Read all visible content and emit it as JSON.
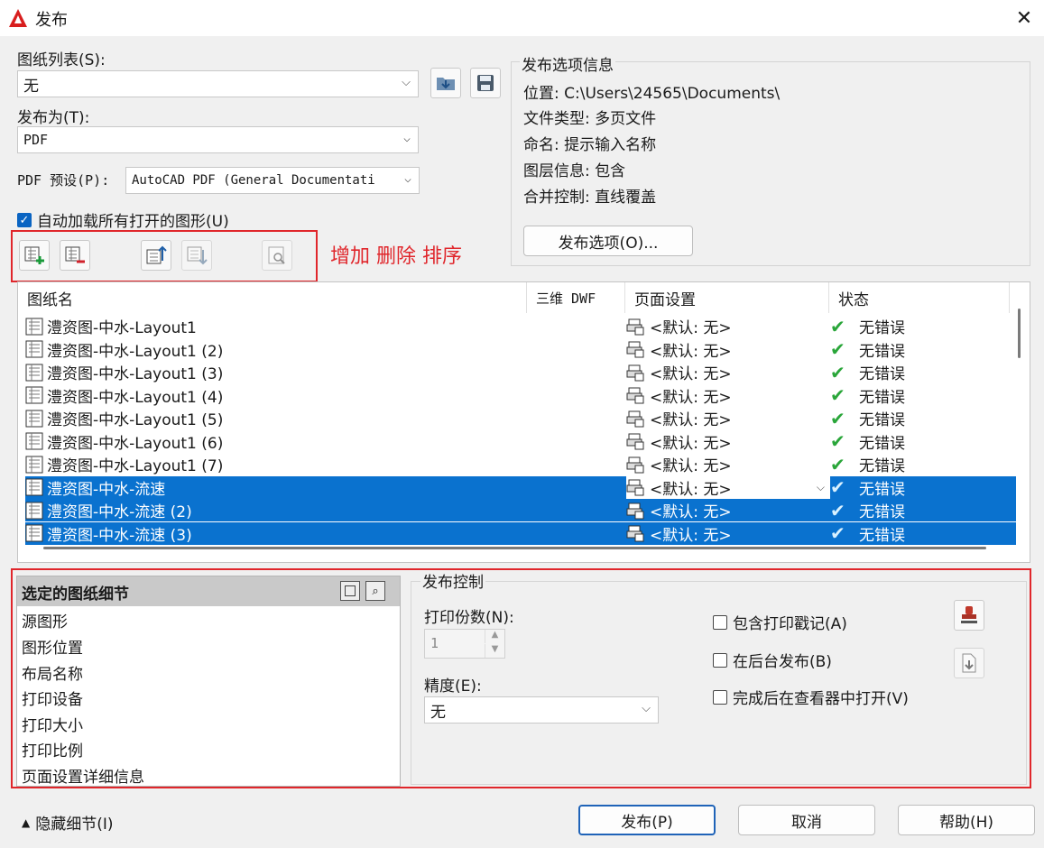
{
  "window": {
    "title": "发布",
    "close_glyph": "✕"
  },
  "sheet_list_label": "图纸列表(S):",
  "sheet_list_value": "无",
  "publish_to_label": "发布为(T):",
  "publish_to_value": "PDF",
  "pdf_preset_label": "PDF 预设(P):",
  "pdf_preset_value": "AutoCAD PDF (General Documentati",
  "auto_load": {
    "label": "自动加载所有打开的图形(U)",
    "checked": true
  },
  "annotation": "增加 删除 排序",
  "info": {
    "legend": "发布选项信息",
    "lines": [
      "位置: C:\\Users\\24565\\Documents\\",
      "文件类型: 多页文件",
      "命名: 提示输入名称",
      "图层信息: 包含",
      "合并控制: 直线覆盖"
    ],
    "options_button": "发布选项(O)..."
  },
  "table": {
    "headers": [
      "图纸名",
      "三维 DWF",
      "页面设置",
      "状态"
    ],
    "rows": [
      {
        "name": "澧资图-中水-Layout1",
        "page_setup": "<默认: 无>",
        "status": "无错误",
        "selected": false
      },
      {
        "name": "澧资图-中水-Layout1 (2)",
        "page_setup": "<默认: 无>",
        "status": "无错误",
        "selected": false
      },
      {
        "name": "澧资图-中水-Layout1 (3)",
        "page_setup": "<默认: 无>",
        "status": "无错误",
        "selected": false
      },
      {
        "name": "澧资图-中水-Layout1 (4)",
        "page_setup": "<默认: 无>",
        "status": "无错误",
        "selected": false
      },
      {
        "name": "澧资图-中水-Layout1 (5)",
        "page_setup": "<默认: 无>",
        "status": "无错误",
        "selected": false
      },
      {
        "name": "澧资图-中水-Layout1 (6)",
        "page_setup": "<默认: 无>",
        "status": "无错误",
        "selected": false
      },
      {
        "name": "澧资图-中水-Layout1 (7)",
        "page_setup": "<默认: 无>",
        "status": "无错误",
        "selected": false
      },
      {
        "name": "澧资图-中水-流速",
        "page_setup": "<默认: 无>",
        "status": "无错误",
        "selected": true
      },
      {
        "name": "澧资图-中水-流速 (2)",
        "page_setup": "<默认: 无>",
        "status": "无错误",
        "selected": true
      },
      {
        "name": "澧资图-中水-流速 (3)",
        "page_setup": "<默认: 无>",
        "status": "无错误",
        "selected": true
      }
    ]
  },
  "details": {
    "title": "选定的图纸细节",
    "items": [
      "源图形",
      "图形位置",
      "布局名称",
      "打印设备",
      "打印大小",
      "打印比例",
      "页面设置详细信息"
    ]
  },
  "publish_control": {
    "legend": "发布控制",
    "copies_label": "打印份数(N):",
    "copies_value": "1",
    "precision_label": "精度(E):",
    "precision_value": "无",
    "include_stamp": "包含打印戳记(A)",
    "background": "在后台发布(B)",
    "open_viewer": "完成后在查看器中打开(V)"
  },
  "footer": {
    "hide_details": "隐藏细节(I)",
    "publish": "发布(P)",
    "cancel": "取消",
    "help": "帮助(H)"
  },
  "colors": {
    "selection": "#0a72cf",
    "annotation_red": "#e0262b",
    "check_green": "#2aa63a"
  }
}
